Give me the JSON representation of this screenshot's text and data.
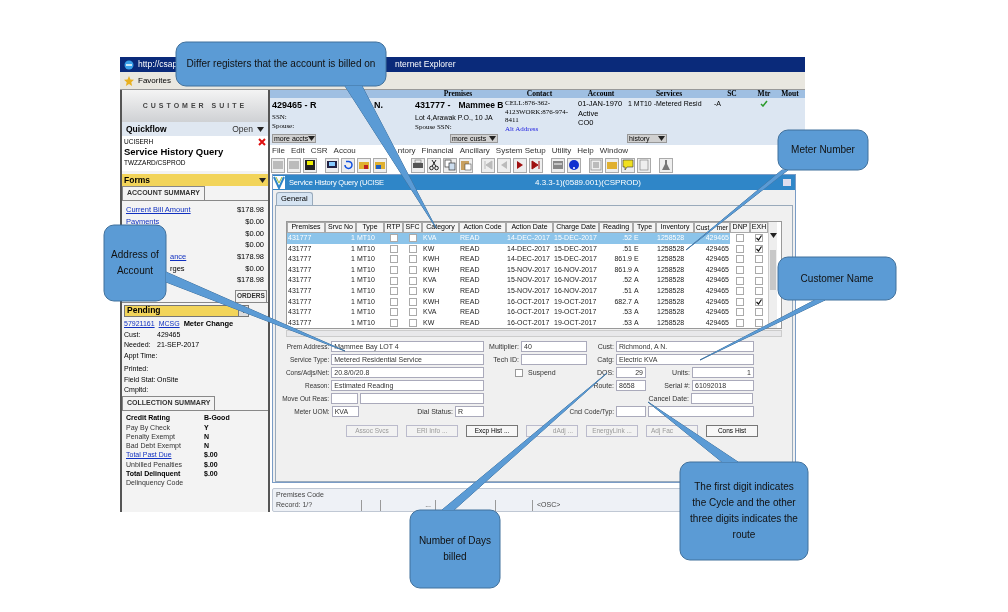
{
  "browser": {
    "title_left": "http://csap",
    "title_right": "nternet Explorer",
    "favorites": "Favorites"
  },
  "left_panel": {
    "brand": "CUSTOMER SUITE",
    "quickflow": {
      "label": "Quickflow",
      "action": "Open"
    },
    "form_code": "UCISERH",
    "form_title": "Service History Query",
    "form_user": "TWZZARD/CSPROD",
    "forms_bar": "Forms",
    "account_summary": {
      "tab": "ACCOUNT SUMMARY",
      "rows": [
        {
          "label": "Current Bill Amount",
          "kind": "link",
          "value": "$178.98"
        },
        {
          "label": "Payments",
          "kind": "link",
          "value": "$0.00"
        },
        {
          "value": "$0.00"
        },
        {
          "value": "$0.00"
        },
        {
          "label": "ance",
          "kind": "link-fragment",
          "value": "$178.98"
        },
        {
          "label": "rges",
          "kind": "text-fragment",
          "value": "$0.00"
        },
        {
          "value": "$178.98"
        }
      ]
    },
    "orders": {
      "tab": "ORDERS",
      "filter": "Pending",
      "order_no": "57921161",
      "order_code": "MCSG",
      "order_type": "Meter Change",
      "fields": [
        {
          "label": "Cust:",
          "value": "429465"
        },
        {
          "label": "Needed:",
          "value": "21-SEP-2017"
        },
        {
          "label": "Appt Time:"
        },
        {
          "label": "Printed:"
        },
        {
          "label": "Field Stat:",
          "value": "OnSite"
        },
        {
          "label": "Cmpltd:"
        }
      ]
    },
    "collection_summary": {
      "tab": "COLLECTION SUMMARY",
      "rows": [
        {
          "label": "Credit Rating",
          "value": "B-Good",
          "kind": "bold"
        },
        {
          "label": "Pay By Check",
          "value": "Y",
          "kind": "plain"
        },
        {
          "label": "Penalty Exempt",
          "value": "N",
          "kind": "plain"
        },
        {
          "label": "Bad Debt Exempt",
          "value": "N",
          "kind": "plain"
        },
        {
          "label": "Total Past Due",
          "value": "$.00",
          "kind": "link"
        },
        {
          "label": "Unbilled Penalties",
          "value": "$.00",
          "kind": "plain"
        },
        {
          "label": "Total Delinquent",
          "value": "$.00",
          "kind": "bold"
        },
        {
          "label": "Delinquency Code",
          "kind": "plain"
        }
      ]
    }
  },
  "header": {
    "columns": [
      "Premises",
      "Contact",
      "Account",
      "Services",
      "SC",
      "Mtr",
      "Mout"
    ],
    "account_name": "429465 - R",
    "account_name_end": "N.",
    "ssn": "SSN:",
    "spouse": "Spouse:",
    "premises_no": "431777 -",
    "premises_name": "Mammee B",
    "premises_address": "Lot 4,Arawak P.O., 10 JA",
    "spouse_ssn": "Spouse SSN:",
    "contact_lines": [
      "CELL:876-362-",
      "4123WORK:876-974-",
      "8411"
    ],
    "alt_address": "Alt Address",
    "account_lines": [
      "01-JAN-1970",
      "Active",
      "CO0"
    ],
    "services": "1 MT10 -Metered Resid",
    "sc": "-A",
    "mtr_checked": true,
    "buttons": [
      "more accts",
      "more custs",
      "history"
    ]
  },
  "menu": [
    "File",
    "Edit",
    "CSR",
    "Accou",
    "ntory",
    "Financial",
    "Ancillary",
    "System Setup",
    "Utility",
    "Help",
    "Window"
  ],
  "window": {
    "title": "Service History Query (UCISE",
    "title_end": "4.3.3-1)(0589.001)(CSPROD)",
    "tabs": [
      {
        "label": "General",
        "selected": true
      }
    ]
  },
  "table": {
    "columns": [
      {
        "label": "Premises"
      },
      {
        "label": "Srvc No"
      },
      {
        "label": "Type"
      },
      {
        "label": "RTP"
      },
      {
        "label": "SFC"
      },
      {
        "label": "Category"
      },
      {
        "label": "Action Code"
      },
      {
        "label": "Action Date"
      },
      {
        "label": "Charge Date"
      },
      {
        "label": "Reading"
      },
      {
        "label": "Type"
      },
      {
        "label": "Inventory"
      },
      {
        "label": "Cust",
        "label_end": "mer"
      },
      {
        "label": "DNP"
      },
      {
        "label": "EXH"
      }
    ],
    "rows": [
      {
        "selected": true,
        "premises": "431777",
        "srvc": "1",
        "type": "MT10",
        "rtp": false,
        "sfc": false,
        "category": "KVA",
        "action": "READ",
        "action_date": "14-DEC-2017",
        "charge_date": "15-DEC-2017",
        "reading": ".52",
        "reading_type": "E",
        "inventory": "1258528",
        "customer": "429465",
        "dnp": false,
        "exh": true
      },
      {
        "selected": false,
        "premises": "431777",
        "srvc": "1",
        "type": "MT10",
        "rtp": false,
        "sfc": false,
        "category": "KW",
        "action": "READ",
        "action_date": "14-DEC-2017",
        "charge_date": "15-DEC-2017",
        "reading": ".51",
        "reading_type": "E",
        "inventory": "1258528",
        "customer": "429465",
        "dnp": false,
        "exh": true
      },
      {
        "selected": false,
        "premises": "431777",
        "srvc": "1",
        "type": "MT10",
        "rtp": false,
        "sfc": false,
        "category": "KWH",
        "action": "READ",
        "action_date": "14-DEC-2017",
        "charge_date": "15-DEC-2017",
        "reading": "861.9",
        "reading_type": "E",
        "inventory": "1258528",
        "customer": "429465",
        "dnp": false,
        "exh": false
      },
      {
        "selected": false,
        "premises": "431777",
        "srvc": "1",
        "type": "MT10",
        "rtp": false,
        "sfc": false,
        "category": "KWH",
        "action": "READ",
        "action_date": "15-NOV-2017",
        "charge_date": "16-NOV-2017",
        "reading": "861.9",
        "reading_type": "A",
        "inventory": "1258528",
        "customer": "429465",
        "dnp": false,
        "exh": false
      },
      {
        "selected": false,
        "premises": "431777",
        "srvc": "1",
        "type": "MT10",
        "rtp": false,
        "sfc": false,
        "category": "KVA",
        "action": "READ",
        "action_date": "15-NOV-2017",
        "charge_date": "16-NOV-2017",
        "reading": ".52",
        "reading_type": "A",
        "inventory": "1258528",
        "customer": "429465",
        "dnp": false,
        "exh": false
      },
      {
        "selected": false,
        "premises": "431777",
        "srvc": "1",
        "type": "MT10",
        "rtp": false,
        "sfc": false,
        "category": "KW",
        "action": "READ",
        "action_date": "15-NOV-2017",
        "charge_date": "16-NOV-2017",
        "reading": ".51",
        "reading_type": "A",
        "inventory": "1258528",
        "customer": "429465",
        "dnp": false,
        "exh": false
      },
      {
        "selected": false,
        "premises": "431777",
        "srvc": "1",
        "type": "MT10",
        "rtp": false,
        "sfc": false,
        "category": "KWH",
        "action": "READ",
        "action_date": "16-OCT-2017",
        "charge_date": "19-OCT-2017",
        "reading": "682.7",
        "reading_type": "A",
        "inventory": "1258528",
        "customer": "429465",
        "dnp": false,
        "exh": true
      },
      {
        "selected": false,
        "premises": "431777",
        "srvc": "1",
        "type": "MT10",
        "rtp": false,
        "sfc": false,
        "category": "KVA",
        "action": "READ",
        "action_date": "16-OCT-2017",
        "charge_date": "19-OCT-2017",
        "reading": ".53",
        "reading_type": "A",
        "inventory": "1258528",
        "customer": "429465",
        "dnp": false,
        "exh": false
      },
      {
        "selected": false,
        "premises": "431777",
        "srvc": "1",
        "type": "MT10",
        "rtp": false,
        "sfc": false,
        "category": "KW",
        "action": "READ",
        "action_date": "16-OCT-2017",
        "charge_date": "19-OCT-2017",
        "reading": ".53",
        "reading_type": "A",
        "inventory": "1258528",
        "customer": "429465",
        "dnp": false,
        "exh": false
      }
    ]
  },
  "form": {
    "left": [
      {
        "label": "Prem Address:",
        "value": "Mammee Bay LOT 4"
      },
      {
        "label": "Service Type:",
        "value": "Metered Residential Service"
      },
      {
        "label": "Cons/Adjs/Net:",
        "value": "20.8/0/20.8"
      },
      {
        "label": "Reason:",
        "value": "Estimated Reading"
      },
      {
        "label": "Move Out Reas:",
        "kind": "split"
      },
      {
        "label": "Meter UOM:",
        "value": "KVA",
        "kind": "pair",
        "label2": "Dial Status:",
        "value2": "R"
      }
    ],
    "middle": [
      {
        "label": "Multiplier:",
        "value": "40"
      },
      {
        "label": "Tech ID:"
      }
    ],
    "suspend": {
      "label": "Suspend",
      "checked": false
    },
    "right": [
      {
        "label": "Cust:",
        "value": "Richmond, A N.",
        "kind": "wide"
      },
      {
        "label": "Catg:",
        "value": "Electric KVA",
        "kind": "wide"
      },
      {
        "label": "DOS:",
        "value": "29",
        "kind": "number-pair",
        "label2": "Units:",
        "value2": "1"
      },
      {
        "label": "Route:",
        "value": "8658",
        "kind": "pair",
        "label2": "Serial #:",
        "value2": "61092018"
      },
      {
        "label": "Cancel Date:",
        "kind": "late"
      },
      {
        "label": "Cncl Code/Typ:",
        "kind": "split"
      }
    ],
    "buttons": [
      {
        "label": "Assoc Svcs",
        "disabled": true
      },
      {
        "label": "ERI Info ...",
        "disabled": true
      },
      {
        "label": "Excp Hist ...",
        "disabled": false
      },
      {
        "label": "dAdj ...",
        "disabled": true
      },
      {
        "label": "EnergyLink ...",
        "disabled": true
      },
      {
        "label": "Adj Fac",
        "disabled": true
      },
      {
        "label": "Cons Hist",
        "disabled": false
      }
    ]
  },
  "status_bar": {
    "hint": "Premises Code",
    "record": "Record: 1/?",
    "more": "...",
    "mode": "<OSC>"
  },
  "callouts": [
    {
      "text": "Differ registers that the account is billed on"
    },
    {
      "text": "Meter Number"
    },
    {
      "text": "Address of Account"
    },
    {
      "text": "Customer Name"
    },
    {
      "text": "The first digit indicates the Cycle and the other three digits indicates the route"
    },
    {
      "text": "Number of Days billed"
    }
  ]
}
